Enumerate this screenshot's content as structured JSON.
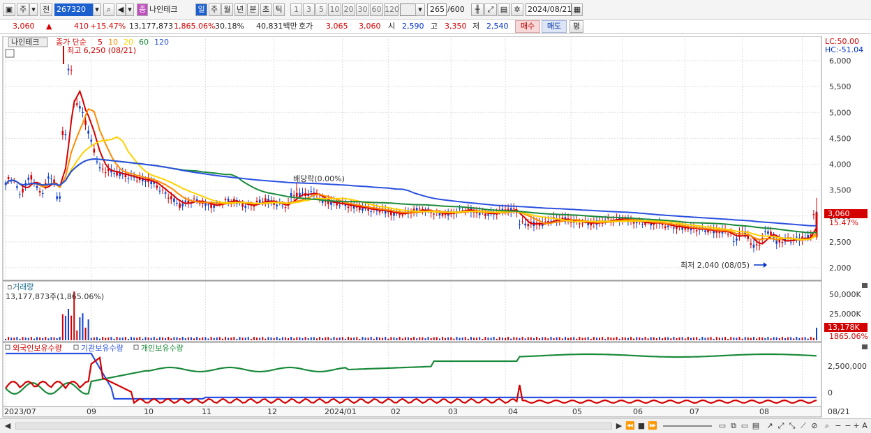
{
  "toolbar": {
    "market_btn": "주",
    "prev_btn": "전",
    "code": "267320",
    "stock_name": "나인테크",
    "stock_badge": "종",
    "periods": [
      "일",
      "주",
      "월",
      "년",
      "분",
      "초",
      "틱"
    ],
    "active_period": "일",
    "intervals": [
      "1",
      "3",
      "5",
      "10",
      "20",
      "30",
      "60",
      "120"
    ],
    "count": "265",
    "count_total": "/600",
    "date": "2024/08/21"
  },
  "quote": {
    "price": "3,060",
    "change": "410",
    "change_pct": "+15.47%",
    "volume": "13,177,873",
    "volume_pct": "1,865.06%",
    "turnover": "30.18%",
    "amount": "40,831백만",
    "hoga_label": "호가",
    "hoga_ask": "3,065",
    "hoga_bid": "3,060",
    "open_label": "시",
    "open": "2,590",
    "high_label": "고",
    "high": "3,350",
    "low_label": "저",
    "low": "2,540",
    "buy_btn": "매수",
    "sell_btn": "매도",
    "eval_btn": "평"
  },
  "price_panel": {
    "name_tag": "나인테크",
    "legend_prefix": "종가 단순",
    "ma_periods": [
      "5",
      "10",
      "20",
      "60",
      "120"
    ],
    "ma_colors": [
      "#d40000",
      "#ff8c00",
      "#ffd200",
      "#1a8a3a",
      "#2a50e0"
    ],
    "lc": "LC:50.00",
    "hc": "HC:-51.04",
    "y_ticks": [
      "6,000",
      "5,500",
      "5,000",
      "4,500",
      "4,000",
      "3,500",
      "3,000",
      "2,500",
      "2,000"
    ],
    "high_annot": "최고 6,250 (08/21)",
    "low_annot": "최저 2,040 (08/05)",
    "div_annot": "배당락(0.00%)",
    "price_tag": "3,060",
    "pct_tag": "15.47%"
  },
  "volume_panel": {
    "title": "거래량",
    "info": "13,177,873주(1,865.06%)",
    "y_ticks": [
      "50,000K",
      "25,000K"
    ],
    "vol_tag": "13,178K",
    "pct_tag": "1865.06%"
  },
  "holding_panel": {
    "legend": [
      "외국인보유수량",
      "기관보유수량",
      "개인보유수량"
    ],
    "legend_colors": [
      "#d40000",
      "#2a50e0",
      "#1a8a3a"
    ],
    "y_ticks": [
      "2,500,000",
      "0"
    ]
  },
  "x_axis": [
    "2023/07",
    "09",
    "10",
    "11",
    "12",
    "2024/01",
    "02",
    "03",
    "04",
    "05",
    "06",
    "07",
    "08",
    "08/21"
  ]
}
